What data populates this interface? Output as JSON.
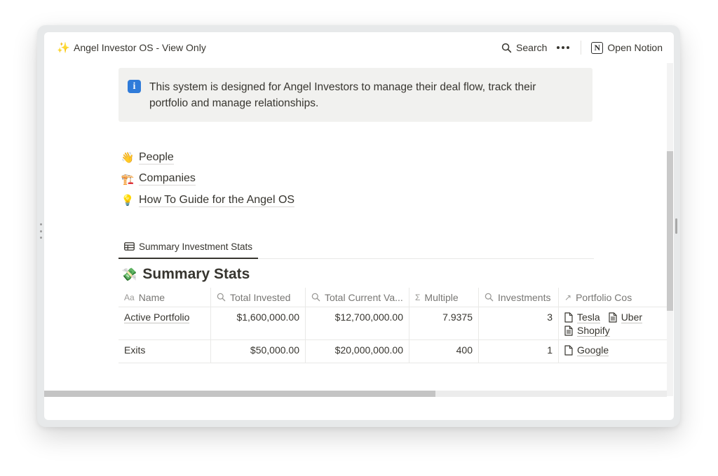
{
  "header": {
    "title": "Angel Investor OS - View Only",
    "sparkle_glyph": "✨",
    "search_label": "Search",
    "open_notion_label": "Open Notion",
    "notion_logo_letter": "N"
  },
  "callout": {
    "icon_glyph": "i",
    "text": "This system is designed for Angel Investors to manage their deal flow, track their portfolio and manage relationships."
  },
  "links": [
    {
      "emoji": "👋",
      "label": "People"
    },
    {
      "emoji": "🏗️",
      "label": "Companies"
    },
    {
      "emoji": "💡",
      "label": "How To Guide for the Angel OS"
    }
  ],
  "database": {
    "tab_label": "Summary Investment Stats",
    "emoji": "💸",
    "title": "Summary Stats",
    "columns": [
      {
        "icon": "Aa",
        "label": "Name"
      },
      {
        "icon": "search-icon",
        "label": "Total Invested"
      },
      {
        "icon": "search-icon",
        "label": "Total Current Va..."
      },
      {
        "icon": "Σ",
        "label": "Multiple"
      },
      {
        "icon": "search-icon",
        "label": "Investments"
      },
      {
        "icon": "↗",
        "label": "Portfolio Cos"
      }
    ],
    "rows": [
      {
        "name": "Active Portfolio",
        "total_invested": "$1,600,000.00",
        "total_current_value": "$12,700,000.00",
        "multiple": "7.9375",
        "investments": "3",
        "portfolio_cos": [
          {
            "label": "Tesla",
            "icon": "page-icon"
          },
          {
            "label": "Uber",
            "icon": "page-text-icon"
          },
          {
            "label": "Shopify",
            "icon": "page-text-icon"
          }
        ]
      },
      {
        "name": "Exits",
        "total_invested": "$50,000.00",
        "total_current_value": "$20,000,000.00",
        "multiple": "400",
        "investments": "1",
        "portfolio_cos": [
          {
            "label": "Google",
            "icon": "page-icon"
          }
        ]
      }
    ]
  },
  "colors": {
    "text": "#37352f",
    "muted": "#787774",
    "callout_bg": "#f1f1ef",
    "info_blue": "#2f7bd9"
  }
}
